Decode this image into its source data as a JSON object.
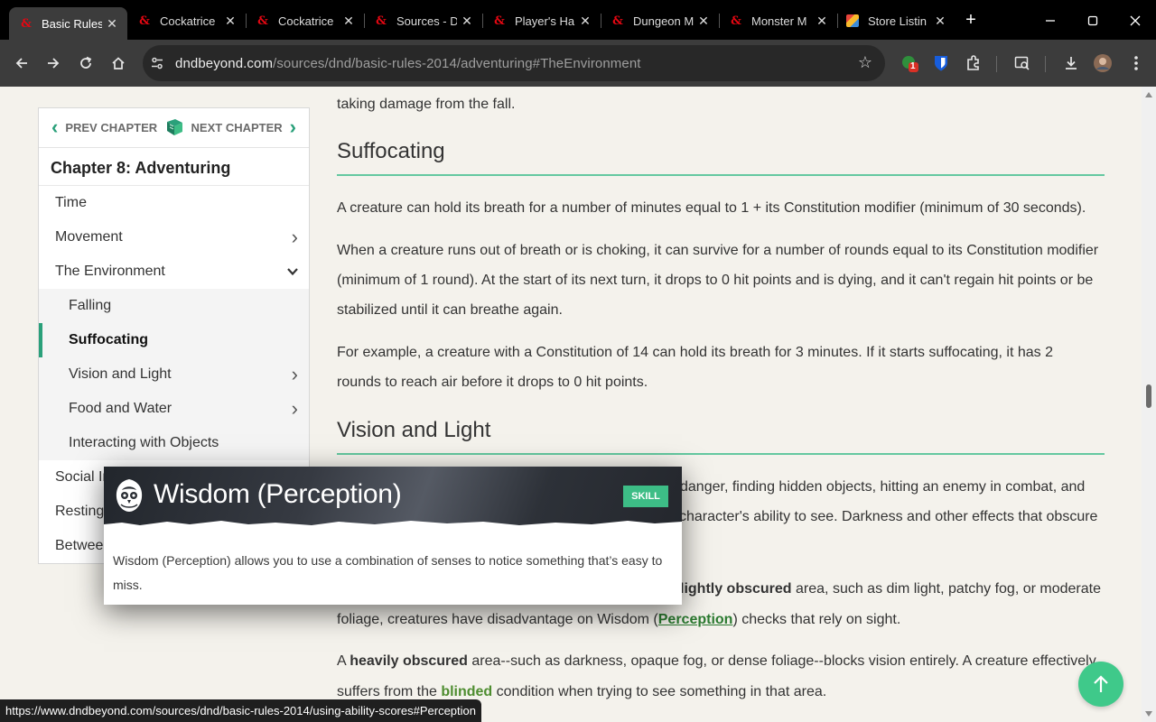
{
  "browser": {
    "tabs": [
      {
        "label": "Basic Rules",
        "active": true,
        "favicon": "dnd-beyond-icon"
      },
      {
        "label": "Cockatrice",
        "active": false,
        "favicon": "dnd-beyond-icon"
      },
      {
        "label": "Cockatrice",
        "active": false,
        "favicon": "dnd-beyond-icon"
      },
      {
        "label": "Sources - D",
        "active": false,
        "favicon": "dnd-beyond-icon"
      },
      {
        "label": "Player's Ha",
        "active": false,
        "favicon": "dnd-beyond-icon"
      },
      {
        "label": "Dungeon M",
        "active": false,
        "favicon": "dnd-beyond-icon"
      },
      {
        "label": "Monster M",
        "active": false,
        "favicon": "dnd-beyond-icon"
      },
      {
        "label": "Store Listin",
        "active": false,
        "favicon": "store-icon"
      }
    ],
    "tab_close_glyph": "✕",
    "new_tab_glyph": "+",
    "url_host": "dndbeyond.com",
    "url_path": "/sources/dnd/basic-rules-2014/adventuring#TheEnvironment",
    "extension_badge": "1",
    "status_url": "https://www.dndbeyond.com/sources/dnd/basic-rules-2014/using-ability-scores#Perception"
  },
  "sidebar": {
    "prev_label": "PREV CHAPTER",
    "next_label": "NEXT CHAPTER",
    "chapter_title": "Chapter 8: Adventuring",
    "items": [
      {
        "label": "Time",
        "level": 0,
        "arrow": ""
      },
      {
        "label": "Movement",
        "level": 0,
        "arrow": "›"
      },
      {
        "label": "The Environment",
        "level": 0,
        "arrow": "⌄"
      },
      {
        "label": "Falling",
        "level": 1,
        "arrow": ""
      },
      {
        "label": "Suffocating",
        "level": 1,
        "arrow": "",
        "active": true
      },
      {
        "label": "Vision and Light",
        "level": 1,
        "arrow": "›"
      },
      {
        "label": "Food and Water",
        "level": 1,
        "arrow": "›"
      },
      {
        "label": "Interacting with Objects",
        "level": 1,
        "arrow": ""
      },
      {
        "label": "Social Interaction",
        "level": 0,
        "arrow": ""
      },
      {
        "label": "Resting",
        "level": 0,
        "arrow": ""
      },
      {
        "label": "Between Adventures",
        "level": 0,
        "arrow": ""
      }
    ]
  },
  "content": {
    "top_fragment": "taking damage from the fall.",
    "suffocating_heading": "Suffocating",
    "suff_p1": "A creature can hold its breath for a number of minutes equal to 1 + its Constitution modifier (minimum of 30 seconds).",
    "suff_p2": "When a creature runs out of breath or is choking, it can survive for a number of rounds equal to its Constitution modifier (minimum of 1 round). At the start of its next turn, it drops to 0 hit points and is dying, and it can't regain hit points or be stabilized until it can breathe again.",
    "suff_p3": "For example, a creature with a Constitution of 14 can hold its breath for 3 minutes. If it starts suffocating, it has 2 rounds to reach air before it drops to 0 hit points.",
    "vision_heading": "Vision and Light",
    "vision_p1_line1": "danger, finding hidden objects, hitting an enemy in combat, and",
    "vision_p1_line2": "character's ability to see. Darkness and other effects that obscure",
    "vision_p2_bold": "lightly obscured",
    "vision_p2_after": " area, such as dim light, patchy fog, or moderate",
    "vision_p2_line2_before": "foliage, creatures have disadvantage on Wisdom (",
    "vision_p2_link": "Perception",
    "vision_p2_line2_after": ") checks that rely on sight.",
    "vision_p3_before": "A ",
    "vision_p3_bold": "heavily obscured",
    "vision_p3_after": " area--such as darkness, opaque fog, or dense foliage--blocks vision entirely. A creature effectively",
    "vision_p3_line2_before": "suffers from the ",
    "vision_p3_link": "blinded",
    "vision_p3_line2_after": " condition when trying to see something in that area."
  },
  "tooltip": {
    "title": "Wisdom (Perception)",
    "badge": "SKILL",
    "body": "Wisdom (Perception) allows you to use a combination of senses to notice something that’s easy to miss."
  },
  "colors": {
    "accent": "#2aa07a",
    "heading_rule": "#64c8a0",
    "skill_badge": "#3dbd86",
    "fab": "#3fc98a"
  }
}
